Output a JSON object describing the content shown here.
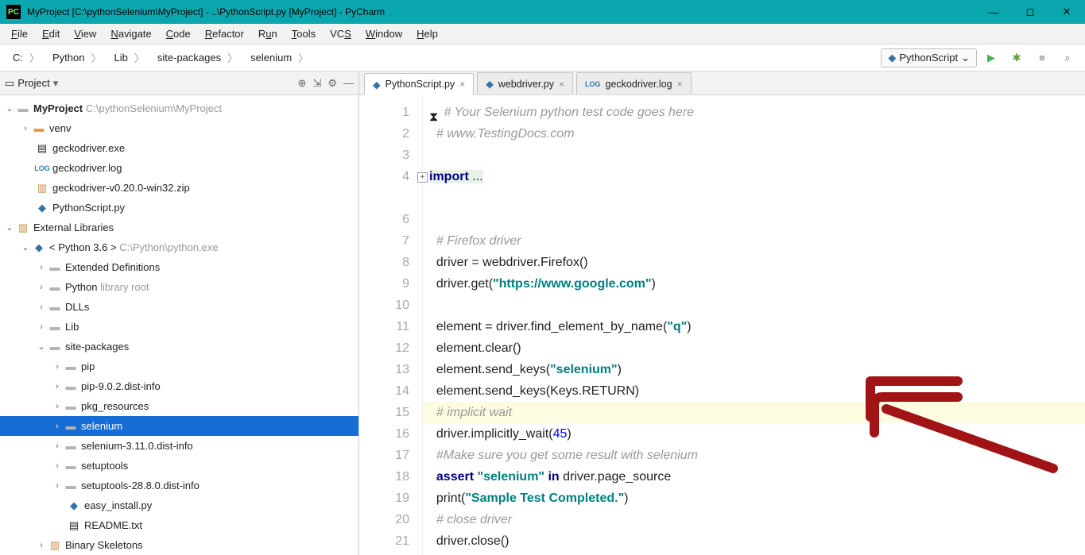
{
  "window": {
    "title": "MyProject [C:\\pythonSelenium\\MyProject] - ..\\PythonScript.py [MyProject] - PyCharm"
  },
  "menu": [
    "File",
    "Edit",
    "View",
    "Navigate",
    "Code",
    "Refactor",
    "Run",
    "Tools",
    "VCS",
    "Window",
    "Help"
  ],
  "breadcrumbs": [
    "C:",
    "Python",
    "Lib",
    "site-packages",
    "selenium"
  ],
  "runconfig": "PythonScript",
  "projectPanel": {
    "title": "Project"
  },
  "tree": {
    "root": {
      "name": "MyProject",
      "path": "C:\\pythonSelenium\\MyProject"
    },
    "venv": "venv",
    "files": [
      "geckodriver.exe",
      "geckodriver.log",
      "geckodriver-v0.20.0-win32.zip",
      "PythonScript.py"
    ],
    "extlib": "External Libraries",
    "python": {
      "name": "< Python 3.6 >",
      "path": "C:\\Python\\python.exe"
    },
    "subs": [
      "Extended Definitions",
      "Python",
      "DLLs",
      "Lib",
      "site-packages"
    ],
    "pythonNote": "library root",
    "sp": [
      "pip",
      "pip-9.0.2.dist-info",
      "pkg_resources",
      "selenium",
      "selenium-3.11.0.dist-info",
      "setuptools",
      "setuptools-28.8.0.dist-info"
    ],
    "spfiles": [
      "easy_install.py",
      "README.txt"
    ],
    "last": "Binary Skeletons"
  },
  "tabs": [
    {
      "name": "PythonScript.py",
      "icon": "py",
      "active": true
    },
    {
      "name": "webdriver.py",
      "icon": "py",
      "active": false
    },
    {
      "name": "geckodriver.log",
      "icon": "log",
      "active": false
    }
  ],
  "code": {
    "l1": "# Your Selenium python test code goes here",
    "l2": "# www.TestingDocs.com",
    "l4a": "import",
    "l4b": " ...",
    "l7": "# Firefox driver",
    "l8a": "driver = webdriver.Firefox()",
    "l9a": "driver.get(",
    "l9b": "\"https://www.google.com\"",
    "l9c": ")",
    "l11a": "element = driver.find_element_by_name(",
    "l11b": "\"q\"",
    "l11c": ")",
    "l12": "element.clear()",
    "l13a": "element.send_keys(",
    "l13b": "\"selenium\"",
    "l13c": ")",
    "l14": "element.send_keys(Keys.RETURN)",
    "l15": "# implicit wait",
    "l16a": "driver.implicitly_wait(",
    "l16b": "45",
    "l16c": ")",
    "l17": "#Make sure you get some result with selenium",
    "l18a": "assert ",
    "l18b": "\"selenium\" ",
    "l18c": "in ",
    "l18d": "driver.page_source",
    "l19a": "print(",
    "l19b": "\"Sample Test Completed.\"",
    "l19c": ")",
    "l20": "# close driver",
    "l21": "driver.close()"
  },
  "lineNumbers": [
    "1",
    "2",
    "3",
    "4",
    "",
    "6",
    "7",
    "8",
    "9",
    "10",
    "11",
    "12",
    "13",
    "14",
    "15",
    "16",
    "17",
    "18",
    "19",
    "20",
    "21"
  ]
}
